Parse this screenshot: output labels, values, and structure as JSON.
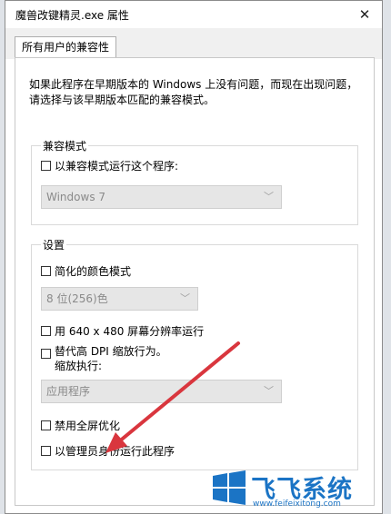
{
  "window": {
    "title": "魔兽改键精灵.exe 属性",
    "close_glyph": "✕"
  },
  "tabs": [
    {
      "label": "所有用户的兼容性"
    }
  ],
  "description": "如果此程序在早期版本的 Windows 上没有问题，而现在出现问题，请选择与该早期版本匹配的兼容模式。",
  "compat_mode": {
    "legend": "兼容模式",
    "checkbox_label": "以兼容模式运行这个程序:",
    "checked": false,
    "dropdown_value": "Windows 7"
  },
  "settings": {
    "legend": "设置",
    "reduced_color": {
      "label": "简化的颜色模式",
      "checked": false
    },
    "color_dropdown": "8 位(256)色",
    "resolution": {
      "label": "用 640 x 480 屏幕分辨率运行",
      "checked": false
    },
    "dpi": {
      "label_line1": "替代高 DPI 缩放行为。",
      "label_line2": "缩放执行:",
      "checked": false
    },
    "dpi_dropdown": "应用程序",
    "fullscreen_opt": {
      "label": "禁用全屏优化",
      "checked": false
    },
    "run_as_admin": {
      "label": "以管理员身份运行此程序",
      "checked": false
    }
  },
  "watermark": {
    "brand": "飞飞系统",
    "url": "www.feifeixitong.com",
    "logo_color": "#1b74c5",
    "arrow_color": "#d9363e"
  }
}
